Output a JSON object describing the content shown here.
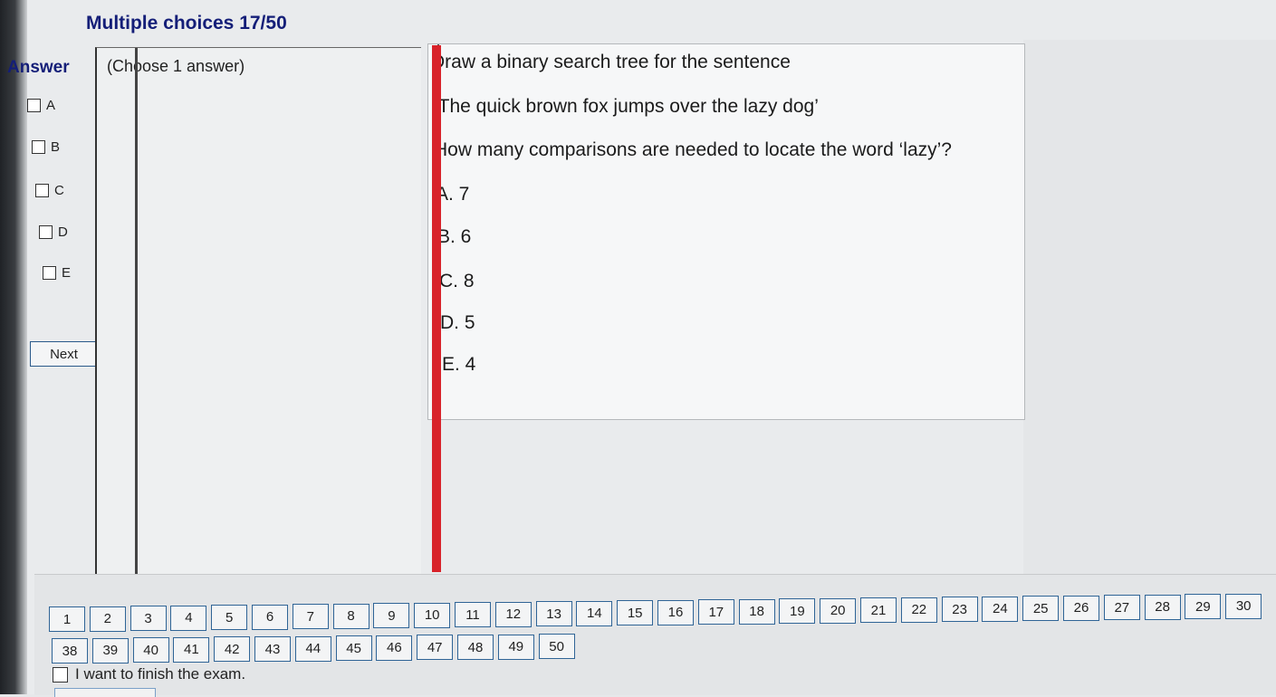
{
  "header": {
    "title": "Multiple choices 17/50"
  },
  "answer_panel": {
    "heading": "Answer",
    "options": [
      "A",
      "B",
      "C",
      "D",
      "E"
    ],
    "next_label": "Next"
  },
  "choose_panel": {
    "text": "(Choose 1 answer)"
  },
  "question": {
    "lines": [
      "Draw a binary search tree for the sentence",
      "‘The quick brown fox jumps over the lazy dog’",
      "How many comparisons are needed to locate the word ‘lazy’?"
    ],
    "choices": [
      "A.  7",
      "B.  6",
      "C.  8",
      "D.  5",
      "E.  4"
    ]
  },
  "navigation": {
    "row1": [
      "1",
      "2",
      "3",
      "4",
      "5",
      "6",
      "7",
      "8",
      "9",
      "10",
      "11",
      "12",
      "13",
      "14",
      "15",
      "16",
      "17",
      "18",
      "19",
      "20",
      "21",
      "22",
      "23",
      "24",
      "25",
      "26",
      "27",
      "28",
      "29",
      "30"
    ],
    "row2": [
      "38",
      "39",
      "40",
      "41",
      "42",
      "43",
      "44",
      "45",
      "46",
      "47",
      "48",
      "49",
      "50"
    ]
  },
  "finish": {
    "label": "I want to finish the exam."
  }
}
